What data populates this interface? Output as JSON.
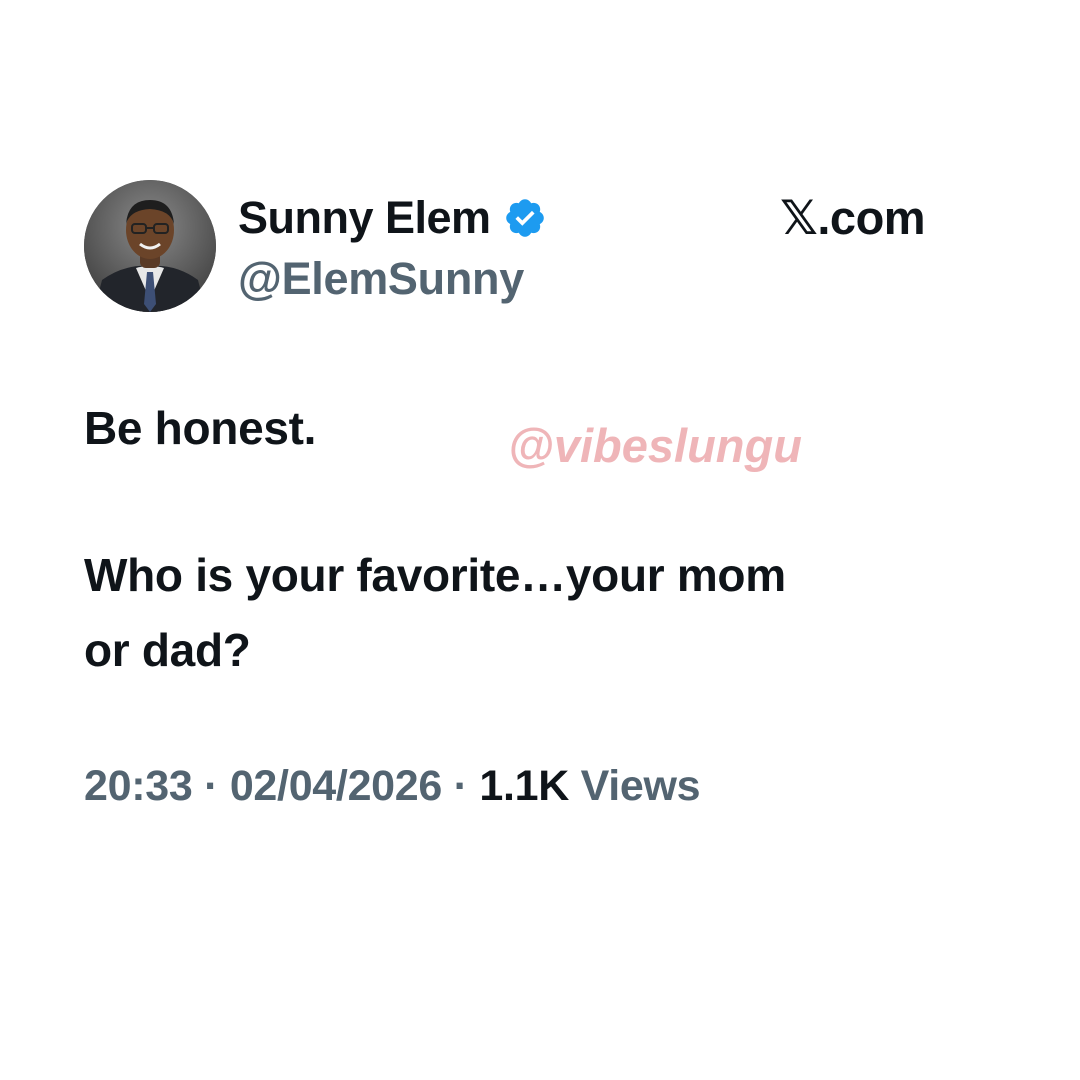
{
  "author": {
    "display_name": "Sunny Elem",
    "handle": "@ElemSunny",
    "verified_icon": "verified-badge-icon",
    "avatar": "profile-photo"
  },
  "brand": {
    "text": "𝕏.com"
  },
  "tweet": {
    "line1": "Be honest.",
    "line2": "Who is your favorite…your mom",
    "line3": "or dad?"
  },
  "watermark": {
    "text": "@vibeslungu"
  },
  "meta": {
    "time": "20:33",
    "separator": " · ",
    "date": "02/04/2026",
    "views_count": "1.1K",
    "views_label": "Views"
  },
  "colors": {
    "text_primary": "#0f1419",
    "text_secondary": "#536471",
    "verified_blue": "#1d9bf0",
    "watermark_pink": "#efb5b8"
  }
}
